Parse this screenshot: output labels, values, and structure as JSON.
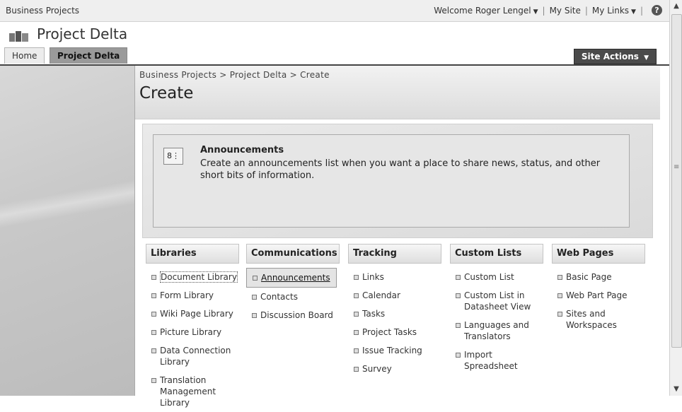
{
  "topbar": {
    "site_name": "Business Projects",
    "welcome": "Welcome Roger Lengel",
    "my_site": "My Site",
    "my_links": "My Links",
    "separator": "|",
    "help_icon": "?"
  },
  "title": "Project Delta",
  "nav": {
    "home": "Home",
    "active": "Project Delta",
    "site_actions": "Site Actions"
  },
  "breadcrumb": "Business Projects > Project Delta > Create",
  "page_title": "Create",
  "description": {
    "title": "Announcements",
    "text": "Create an announcements list when you want a place to share news, status, and other short bits of information."
  },
  "categories": [
    {
      "header": "Libraries",
      "items": [
        "Document Library",
        "Form Library",
        "Wiki Page Library",
        "Picture Library",
        "Data Connection Library",
        "Translation Management Library"
      ]
    },
    {
      "header": "Communications",
      "items": [
        "Announcements",
        "Contacts",
        "Discussion Board"
      ]
    },
    {
      "header": "Tracking",
      "items": [
        "Links",
        "Calendar",
        "Tasks",
        "Project Tasks",
        "Issue Tracking",
        "Survey"
      ]
    },
    {
      "header": "Custom Lists",
      "items": [
        "Custom List",
        "Custom List in Datasheet View",
        "Languages and Translators",
        "Import Spreadsheet"
      ]
    },
    {
      "header": "Web Pages",
      "items": [
        "Basic Page",
        "Web Part Page",
        "Sites and Workspaces"
      ]
    }
  ]
}
